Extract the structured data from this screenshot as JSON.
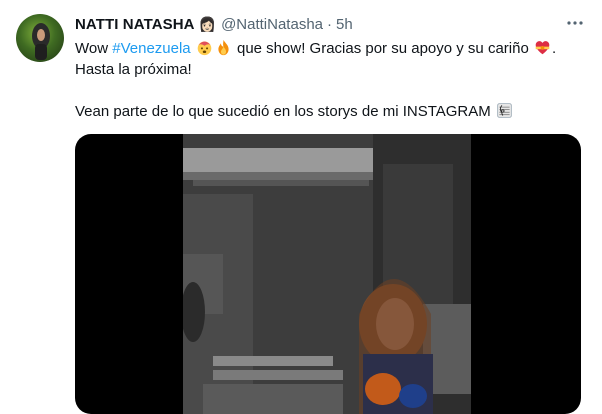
{
  "author": {
    "name": "NATTI NATASHA",
    "name_emoji": "👩🏻",
    "handle": "@NattiNatasha",
    "separator": "·",
    "time": "5h"
  },
  "tweet": {
    "line1": {
      "prefix": "Wow ",
      "hashtag": "#Venezuela",
      "emojis": [
        "exploding-head-emoji",
        "fire-emoji"
      ],
      "middle": " que show! Gracias por su apoyo y su cariño ",
      "end_emoji": "heart-with-ribbon-emoji",
      "suffix": "."
    },
    "line2": "Hasta la próxima!",
    "line3": "Vean parte de lo que sucedió en los storys de mi INSTAGRAM",
    "line3_emoji": "musical-score-emoji"
  },
  "icons": {
    "more": "more-options-icon"
  },
  "media": {
    "type": "video",
    "background": "#000000"
  },
  "colors": {
    "text": "#0f1419",
    "secondary": "#536471",
    "link": "#1d9bf0"
  }
}
